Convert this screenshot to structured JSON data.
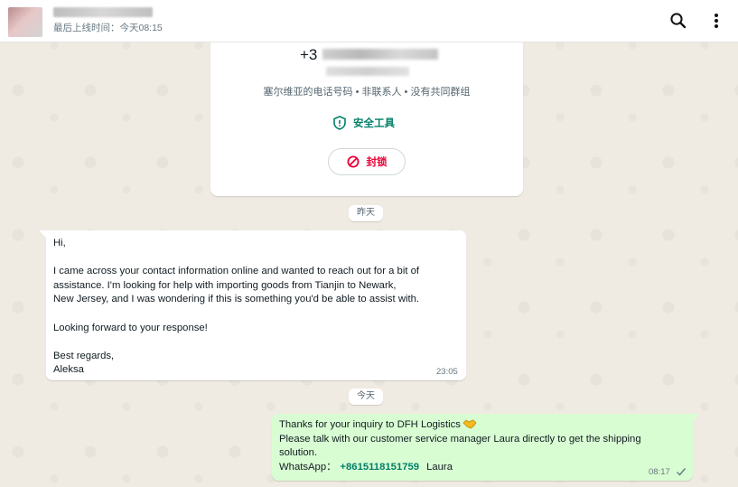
{
  "header": {
    "last_seen": "最后上线时间：今天08:15",
    "icons": [
      "search-icon",
      "more-vert-icon"
    ]
  },
  "contact_card": {
    "phone_prefix": "+3",
    "description": "塞尔维亚的电话号码 • 非联系人 • 没有共同群组",
    "safety_tools_label": "安全工具",
    "block_label": "封锁"
  },
  "dates": {
    "yesterday": "昨天",
    "today": "今天"
  },
  "messages": [
    {
      "direction": "incoming",
      "text": "Hi,\n\nI came across your contact information online and wanted to reach out for a bit of\nassistance. I'm looking for help with importing goods from Tianjin to Newark,\nNew Jersey, and I was wondering if this is something you'd be able to assist with.\n\nLooking forward to your response!\n\nBest regards,\nAleksa",
      "time": "23:05"
    },
    {
      "direction": "outgoing",
      "line1": "Thanks for your inquiry to DFH Logistics",
      "line2": "Please talk with our customer service manager Laura directly to get the shipping",
      "line3": "solution.",
      "whatsapp_label": "WhatsApp：",
      "whatsapp_number": "+8615118151759",
      "contact_name": "Laura",
      "time": "08:17",
      "status": "sent"
    }
  ],
  "colors": {
    "chat_bg": "#efeae2",
    "outgoing_bubble": "#d9fdd3",
    "accent_green": "#008069",
    "block_red": "#ea0038"
  }
}
